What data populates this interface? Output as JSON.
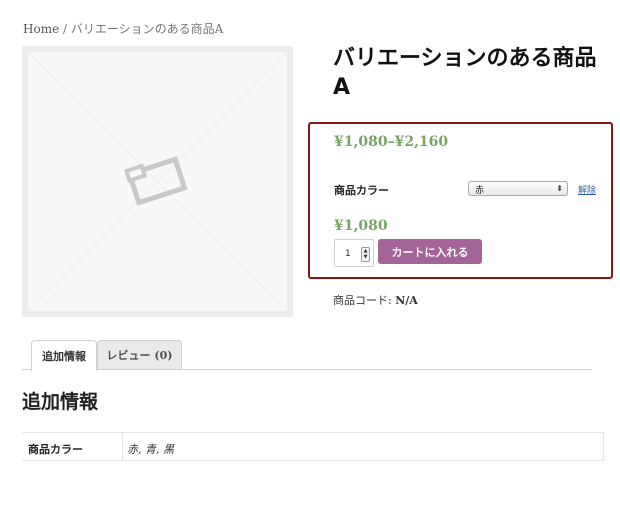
{
  "breadcrumb": {
    "home": "Home",
    "separator": " / ",
    "current": "バリエーションのある商品A"
  },
  "product": {
    "title": "バリエーションのある商品A",
    "price_range": "¥1,080–¥2,160",
    "variation_label": "商品カラー",
    "variation_selected": "赤",
    "reset_label": "解除",
    "variation_price": "¥1,080",
    "quantity": "1",
    "add_to_cart_label": "カートに入れる",
    "sku_label": "商品コード: ",
    "sku_value": "N/A"
  },
  "tabs": [
    {
      "label": "追加情報",
      "active": true
    },
    {
      "label": "レビュー (0)",
      "active": false
    }
  ],
  "additional_info": {
    "heading": "追加情報",
    "rows": [
      {
        "name": "商品カラー",
        "value": "赤, 青, 黒"
      }
    ]
  },
  "colors": {
    "price": "#77a464",
    "button": "#a46497",
    "highlight_border": "#8a1416",
    "link": "#2f5fa8"
  }
}
